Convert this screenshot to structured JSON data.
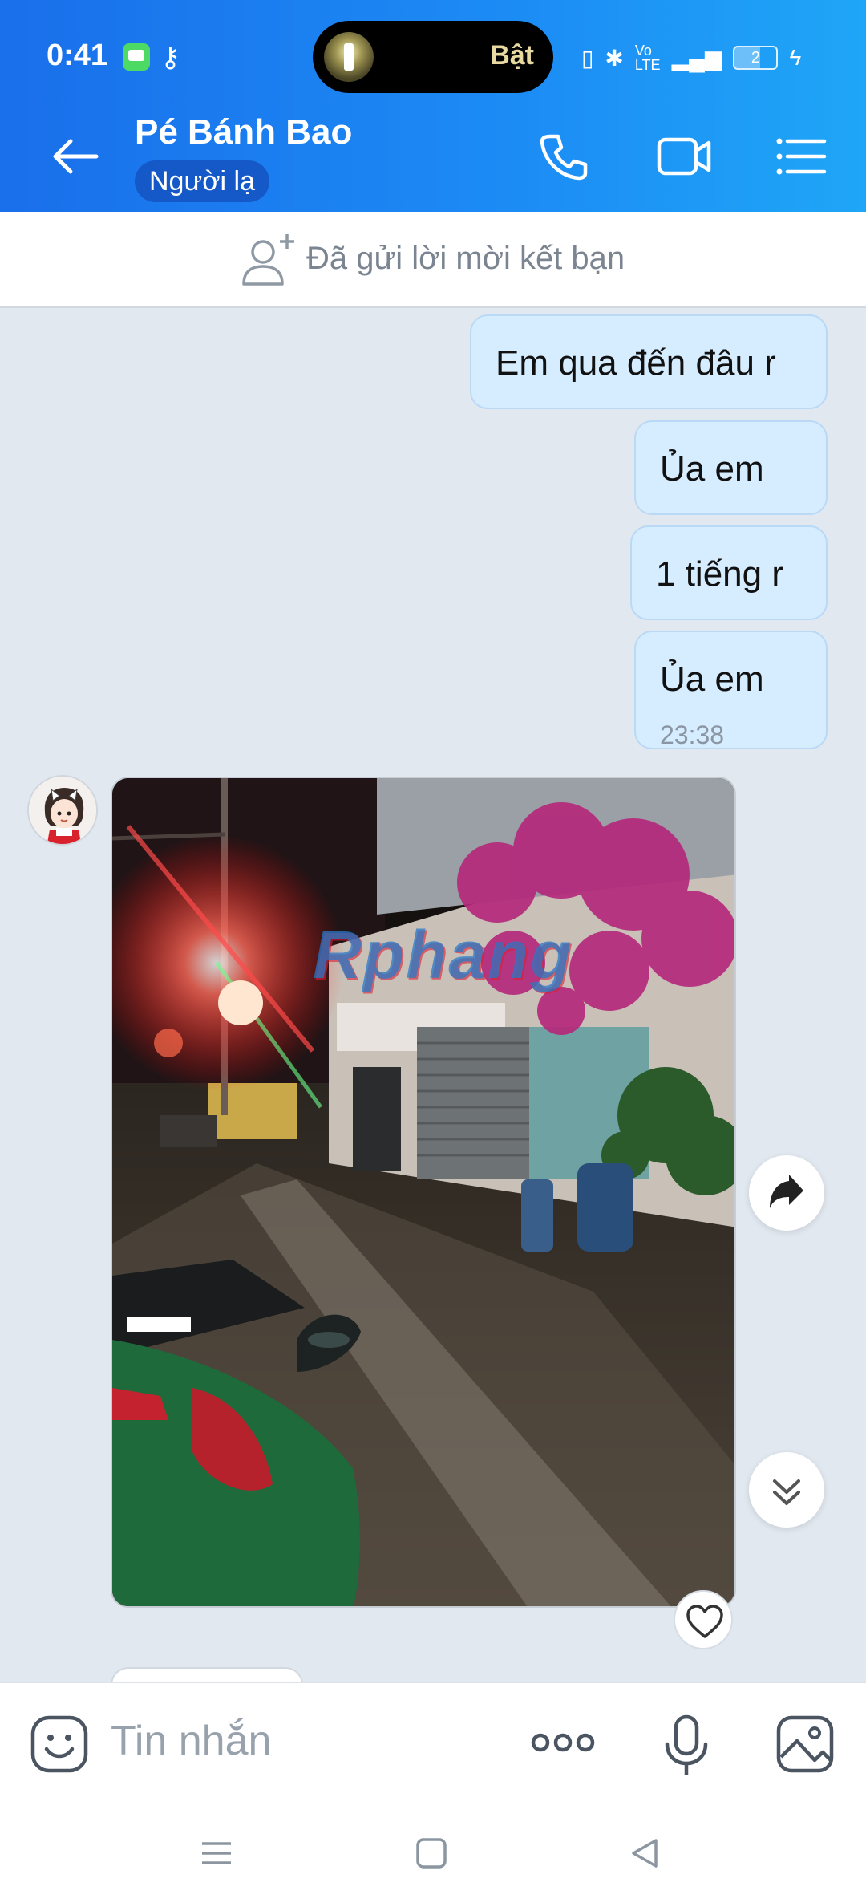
{
  "status": {
    "time": "0:41",
    "pill_label": "Bật",
    "battery": "2"
  },
  "header": {
    "contact_name": "Pé Bánh Bao",
    "badge": "Người lạ"
  },
  "friend_request": {
    "text": "Đã gửi lời mời kết bạn"
  },
  "messages": [
    {
      "text": "Em qua đến đâu r"
    },
    {
      "text": "Ủa em"
    },
    {
      "text": "1 tiếng r"
    },
    {
      "text": "Ủa em",
      "time": "23:38"
    }
  ],
  "photo": {
    "watermark": "Rphang"
  },
  "input": {
    "placeholder": "Tin nhắn"
  },
  "colors": {
    "header_start": "#1a6fea",
    "header_end": "#1fa6f7",
    "bubble_out": "#d6ecff",
    "chat_bg": "#e2e8f0"
  }
}
